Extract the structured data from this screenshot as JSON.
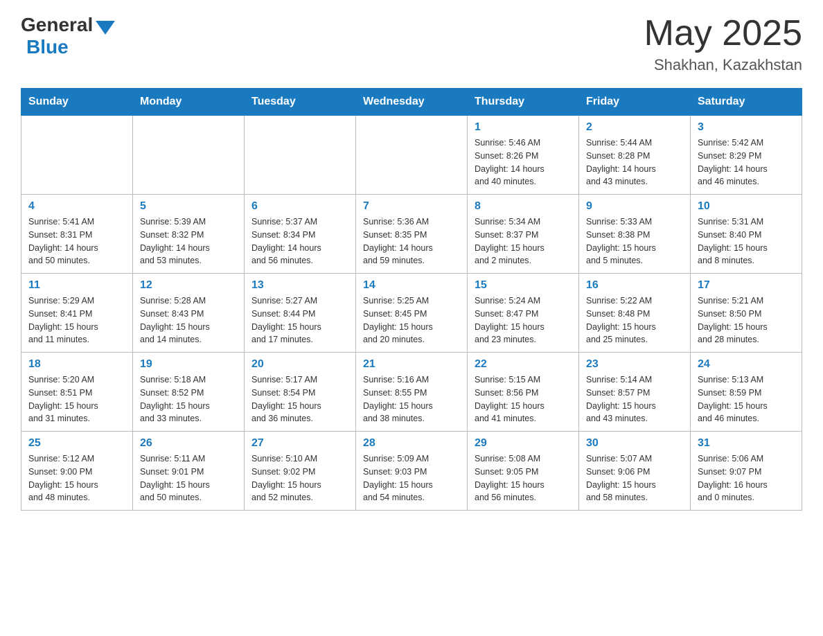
{
  "logo": {
    "general": "General",
    "blue": "Blue"
  },
  "title": {
    "month_year": "May 2025",
    "location": "Shakhan, Kazakhstan"
  },
  "weekdays": [
    "Sunday",
    "Monday",
    "Tuesday",
    "Wednesday",
    "Thursday",
    "Friday",
    "Saturday"
  ],
  "weeks": [
    [
      {
        "day": "",
        "info": ""
      },
      {
        "day": "",
        "info": ""
      },
      {
        "day": "",
        "info": ""
      },
      {
        "day": "",
        "info": ""
      },
      {
        "day": "1",
        "info": "Sunrise: 5:46 AM\nSunset: 8:26 PM\nDaylight: 14 hours\nand 40 minutes."
      },
      {
        "day": "2",
        "info": "Sunrise: 5:44 AM\nSunset: 8:28 PM\nDaylight: 14 hours\nand 43 minutes."
      },
      {
        "day": "3",
        "info": "Sunrise: 5:42 AM\nSunset: 8:29 PM\nDaylight: 14 hours\nand 46 minutes."
      }
    ],
    [
      {
        "day": "4",
        "info": "Sunrise: 5:41 AM\nSunset: 8:31 PM\nDaylight: 14 hours\nand 50 minutes."
      },
      {
        "day": "5",
        "info": "Sunrise: 5:39 AM\nSunset: 8:32 PM\nDaylight: 14 hours\nand 53 minutes."
      },
      {
        "day": "6",
        "info": "Sunrise: 5:37 AM\nSunset: 8:34 PM\nDaylight: 14 hours\nand 56 minutes."
      },
      {
        "day": "7",
        "info": "Sunrise: 5:36 AM\nSunset: 8:35 PM\nDaylight: 14 hours\nand 59 minutes."
      },
      {
        "day": "8",
        "info": "Sunrise: 5:34 AM\nSunset: 8:37 PM\nDaylight: 15 hours\nand 2 minutes."
      },
      {
        "day": "9",
        "info": "Sunrise: 5:33 AM\nSunset: 8:38 PM\nDaylight: 15 hours\nand 5 minutes."
      },
      {
        "day": "10",
        "info": "Sunrise: 5:31 AM\nSunset: 8:40 PM\nDaylight: 15 hours\nand 8 minutes."
      }
    ],
    [
      {
        "day": "11",
        "info": "Sunrise: 5:29 AM\nSunset: 8:41 PM\nDaylight: 15 hours\nand 11 minutes."
      },
      {
        "day": "12",
        "info": "Sunrise: 5:28 AM\nSunset: 8:43 PM\nDaylight: 15 hours\nand 14 minutes."
      },
      {
        "day": "13",
        "info": "Sunrise: 5:27 AM\nSunset: 8:44 PM\nDaylight: 15 hours\nand 17 minutes."
      },
      {
        "day": "14",
        "info": "Sunrise: 5:25 AM\nSunset: 8:45 PM\nDaylight: 15 hours\nand 20 minutes."
      },
      {
        "day": "15",
        "info": "Sunrise: 5:24 AM\nSunset: 8:47 PM\nDaylight: 15 hours\nand 23 minutes."
      },
      {
        "day": "16",
        "info": "Sunrise: 5:22 AM\nSunset: 8:48 PM\nDaylight: 15 hours\nand 25 minutes."
      },
      {
        "day": "17",
        "info": "Sunrise: 5:21 AM\nSunset: 8:50 PM\nDaylight: 15 hours\nand 28 minutes."
      }
    ],
    [
      {
        "day": "18",
        "info": "Sunrise: 5:20 AM\nSunset: 8:51 PM\nDaylight: 15 hours\nand 31 minutes."
      },
      {
        "day": "19",
        "info": "Sunrise: 5:18 AM\nSunset: 8:52 PM\nDaylight: 15 hours\nand 33 minutes."
      },
      {
        "day": "20",
        "info": "Sunrise: 5:17 AM\nSunset: 8:54 PM\nDaylight: 15 hours\nand 36 minutes."
      },
      {
        "day": "21",
        "info": "Sunrise: 5:16 AM\nSunset: 8:55 PM\nDaylight: 15 hours\nand 38 minutes."
      },
      {
        "day": "22",
        "info": "Sunrise: 5:15 AM\nSunset: 8:56 PM\nDaylight: 15 hours\nand 41 minutes."
      },
      {
        "day": "23",
        "info": "Sunrise: 5:14 AM\nSunset: 8:57 PM\nDaylight: 15 hours\nand 43 minutes."
      },
      {
        "day": "24",
        "info": "Sunrise: 5:13 AM\nSunset: 8:59 PM\nDaylight: 15 hours\nand 46 minutes."
      }
    ],
    [
      {
        "day": "25",
        "info": "Sunrise: 5:12 AM\nSunset: 9:00 PM\nDaylight: 15 hours\nand 48 minutes."
      },
      {
        "day": "26",
        "info": "Sunrise: 5:11 AM\nSunset: 9:01 PM\nDaylight: 15 hours\nand 50 minutes."
      },
      {
        "day": "27",
        "info": "Sunrise: 5:10 AM\nSunset: 9:02 PM\nDaylight: 15 hours\nand 52 minutes."
      },
      {
        "day": "28",
        "info": "Sunrise: 5:09 AM\nSunset: 9:03 PM\nDaylight: 15 hours\nand 54 minutes."
      },
      {
        "day": "29",
        "info": "Sunrise: 5:08 AM\nSunset: 9:05 PM\nDaylight: 15 hours\nand 56 minutes."
      },
      {
        "day": "30",
        "info": "Sunrise: 5:07 AM\nSunset: 9:06 PM\nDaylight: 15 hours\nand 58 minutes."
      },
      {
        "day": "31",
        "info": "Sunrise: 5:06 AM\nSunset: 9:07 PM\nDaylight: 16 hours\nand 0 minutes."
      }
    ]
  ]
}
